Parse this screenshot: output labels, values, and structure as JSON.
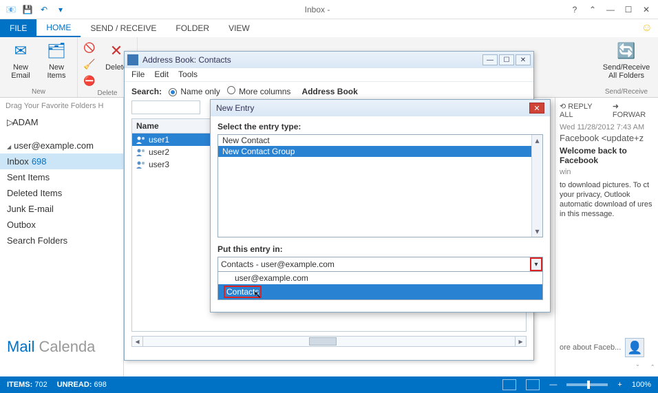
{
  "titlebar": {
    "title": "Inbox -"
  },
  "tabs": {
    "file": "FILE",
    "home": "HOME",
    "sendreceive": "SEND / RECEIVE",
    "folder": "FOLDER",
    "view": "VIEW"
  },
  "ribbon": {
    "new_email": "New Email",
    "new_items": "New Items",
    "delete": "Delete",
    "send_receive_all": "Send/Receive All Folders",
    "group_new": "New",
    "group_delete": "Delete",
    "group_sendreceive": "Send/Receive"
  },
  "nav": {
    "fav_hint": "Drag Your Favorite Folders H",
    "adam": "ADAM",
    "account": "user@example.com",
    "items": [
      {
        "label": "Inbox",
        "count": "698",
        "sel": true
      },
      {
        "label": "Sent Items"
      },
      {
        "label": "Deleted Items"
      },
      {
        "label": "Junk E-mail"
      },
      {
        "label": "Outbox"
      },
      {
        "label": "Search Folders"
      }
    ],
    "module_mail": "Mail",
    "module_calendar": "Calenda"
  },
  "reading": {
    "reply_all": "REPLY ALL",
    "forward": "FORWAR",
    "date": "Wed 11/28/2012 7:43 AM",
    "from": "Facebook <update+z",
    "subject": "Welcome back to Facebook",
    "to_line": "win",
    "body": "to download pictures. To ct your privacy, Outlook automatic download of ures in this message.",
    "about": "ore about Faceb..."
  },
  "status": {
    "items_label": "ITEMS:",
    "items": "702",
    "unread_label": "UNREAD:",
    "unread": "698",
    "zoom": "100%"
  },
  "abook": {
    "title": "Address Book: Contacts",
    "menu": {
      "file": "File",
      "edit": "Edit",
      "tools": "Tools"
    },
    "search_label": "Search:",
    "name_only": "Name only",
    "more_cols": "More columns",
    "ab_label": "Address Book",
    "col_name": "Name",
    "rows": [
      "user1",
      "user2",
      "user3"
    ]
  },
  "newentry": {
    "title": "New Entry",
    "select_label": "Select the entry type:",
    "options": [
      "New Contact",
      "New Contact Group"
    ],
    "put_label": "Put this entry in:",
    "dd_value": "Contacts - user@example.com",
    "dd_items": [
      "user@example.com",
      "Contacts"
    ]
  }
}
